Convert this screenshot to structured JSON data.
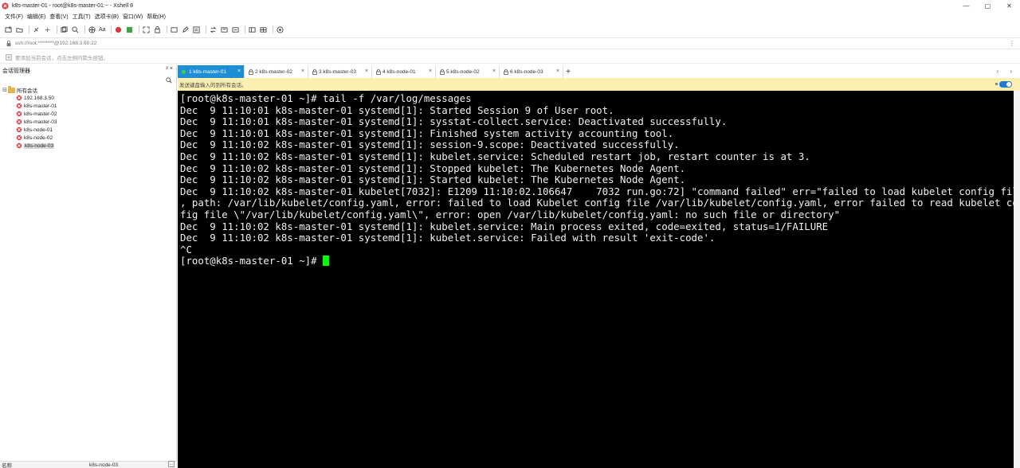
{
  "window": {
    "title": "k8s-master-01 - root@k8s-master-01:~ - Xshell 8",
    "controls": [
      "—",
      "▢",
      "✕"
    ]
  },
  "menu": [
    "文件(F)",
    "编辑(E)",
    "查看(V)",
    "工具(T)",
    "选项卡(B)",
    "窗口(W)",
    "帮助(H)"
  ],
  "toolbar": {
    "font_label": "Aa"
  },
  "address": {
    "value": "ssh://root:********@192.168.3.60:22",
    "hint": "要添加当前会话，点击左侧的箭头按钮。"
  },
  "sessions": {
    "header": "会话管理器",
    "pin": "ᵖ ×",
    "root": "所有会话",
    "items": [
      "192.168.3.50",
      "k8s-master-01",
      "k8s-master-02",
      "k8s-master-03",
      "k8s-node-01",
      "k8s-node-02",
      "k8s-node-03"
    ],
    "selected_index": 6,
    "footer": {
      "key": "名称",
      "value": "k8s-node-03",
      "more": "..."
    }
  },
  "tabs": [
    {
      "label": "1 k8s-master-01",
      "active": true
    },
    {
      "label": "2 k8s-master-02",
      "active": false
    },
    {
      "label": "3 k8s-master-03",
      "active": false
    },
    {
      "label": "4 k8s-node-01",
      "active": false
    },
    {
      "label": "5 k8s-node-02",
      "active": false
    },
    {
      "label": "6 k8s-node-03",
      "active": false
    }
  ],
  "tab_add": "+",
  "tab_nav": "‹ ›",
  "compose_hint": "发送键盘输入的到所有会话。",
  "terminal": {
    "lines": [
      "[root@k8s-master-01 ~]# tail -f /var/log/messages",
      "Dec  9 11:10:01 k8s-master-01 systemd[1]: Started Session 9 of User root.",
      "Dec  9 11:10:01 k8s-master-01 systemd[1]: sysstat-collect.service: Deactivated successfully.",
      "Dec  9 11:10:01 k8s-master-01 systemd[1]: Finished system activity accounting tool.",
      "Dec  9 11:10:02 k8s-master-01 systemd[1]: session-9.scope: Deactivated successfully.",
      "Dec  9 11:10:02 k8s-master-01 systemd[1]: kubelet.service: Scheduled restart job, restart counter is at 3.",
      "Dec  9 11:10:02 k8s-master-01 systemd[1]: Stopped kubelet: The Kubernetes Node Agent.",
      "Dec  9 11:10:02 k8s-master-01 systemd[1]: Started kubelet: The Kubernetes Node Agent.",
      "Dec  9 11:10:02 k8s-master-01 kubelet[7032]: E1209 11:10:02.106647    7032 run.go:72] \"command failed\" err=\"failed to load kubelet config file",
      ", path: /var/lib/kubelet/config.yaml, error: failed to load Kubelet config file /var/lib/kubelet/config.yaml, error failed to read kubelet con",
      "fig file \\\"/var/lib/kubelet/config.yaml\\\", error: open /var/lib/kubelet/config.yaml: no such file or directory\"",
      "Dec  9 11:10:02 k8s-master-01 systemd[1]: kubelet.service: Main process exited, code=exited, status=1/FAILURE",
      "Dec  9 11:10:02 k8s-master-01 systemd[1]: kubelet.service: Failed with result 'exit-code'.",
      "^C"
    ],
    "prompt": "[root@k8s-master-01 ~]# "
  },
  "colors": {
    "tab_active": "#1e8fd6",
    "terminal_bg": "#000000",
    "terminal_fg": "#f0f0f0",
    "cursor": "#00ff00",
    "compose_bg": "#fbefb1"
  }
}
